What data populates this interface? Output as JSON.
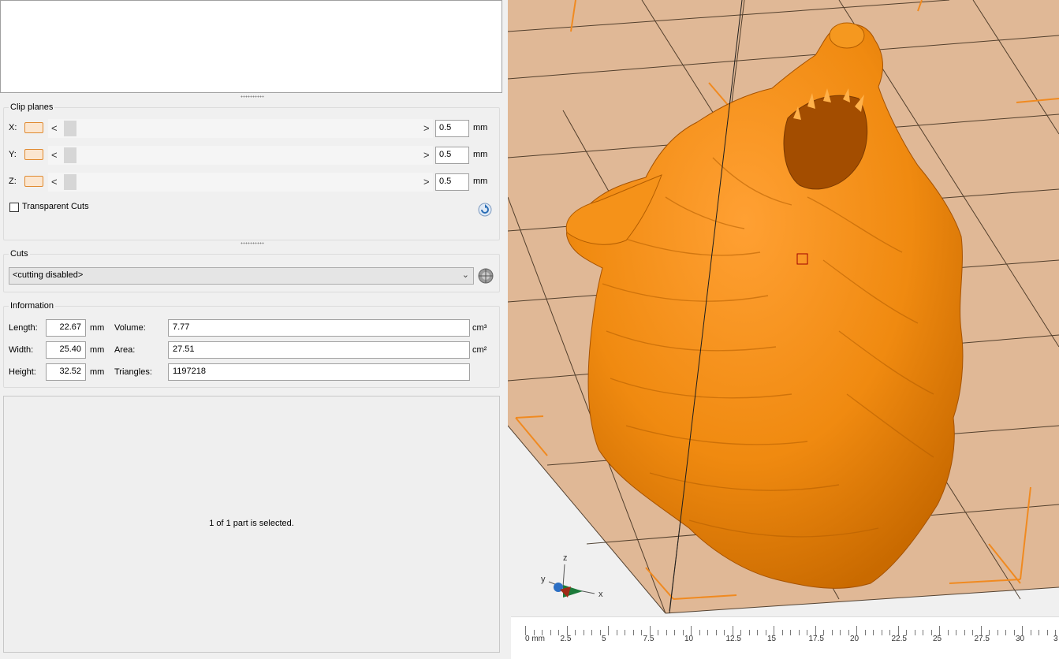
{
  "clip_planes": {
    "title": "Clip planes",
    "axes": [
      {
        "label": "X:",
        "value": "0.5",
        "unit": "mm"
      },
      {
        "label": "Y:",
        "value": "0.5",
        "unit": "mm"
      },
      {
        "label": "Z:",
        "value": "0.5",
        "unit": "mm"
      }
    ],
    "transparent_cuts_label": "Transparent Cuts",
    "transparent_cuts_checked": false,
    "arrow_left": "<",
    "arrow_right": ">"
  },
  "cuts": {
    "title": "Cuts",
    "selected": "<cutting disabled>"
  },
  "information": {
    "title": "Information",
    "length_label": "Length:",
    "length_value": "22.67",
    "width_label": "Width:",
    "width_value": "25.40",
    "height_label": "Height:",
    "height_value": "32.52",
    "dim_unit": "mm",
    "volume_label": "Volume:",
    "volume_value": "7.77",
    "volume_unit": "cm³",
    "area_label": "Area:",
    "area_value": "27.51",
    "area_unit": "cm²",
    "triangles_label": "Triangles:",
    "triangles_value": "1197218"
  },
  "status": "1 of 1 part is selected.",
  "axis_gizmo": {
    "x": "x",
    "y": "y",
    "z": "z"
  },
  "ruler": {
    "labels": [
      "0 mm",
      "2.5",
      "5",
      "7.5",
      "10",
      "12.5",
      "15",
      "17.5",
      "20",
      "22.5",
      "25",
      "27.5",
      "30",
      "3"
    ]
  },
  "colors": {
    "model": "#f08a10",
    "plate": "#e0b896",
    "accent": "#e08a30"
  }
}
